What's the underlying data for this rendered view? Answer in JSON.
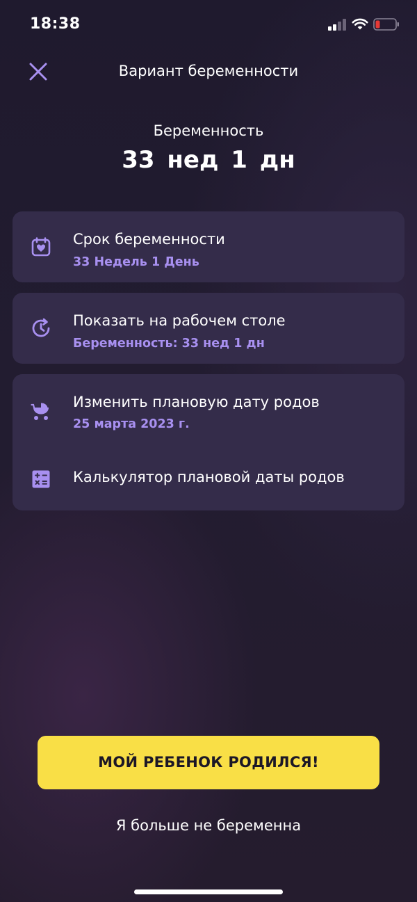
{
  "status_bar": {
    "time": "18:38",
    "icons": [
      "cellular-signal-icon",
      "wifi-icon",
      "battery-low-icon"
    ],
    "battery_color": "#e53935"
  },
  "header": {
    "title": "Вариант беременности",
    "close_icon": "close-icon"
  },
  "summary": {
    "label": "Беременность",
    "value": "33 нед 1 дн"
  },
  "card_term": {
    "icon": "calendar-heart-icon",
    "title": "Срок беременности",
    "subtitle": "33 Недель 1 День"
  },
  "card_widget": {
    "icon": "clock-refresh-icon",
    "title": "Показать на рабочем столе",
    "subtitle": "Беременность: 33 нед 1 дн"
  },
  "card_due": {
    "items": [
      {
        "icon": "stroller-icon",
        "title": "Изменить плановую дату родов",
        "subtitle": "25 марта 2023 г."
      },
      {
        "icon": "calculator-icon",
        "title": "Калькулятор плановой даты родов"
      }
    ]
  },
  "actions": {
    "born_button": "МОЙ РЕБЕНОК РОДИЛСЯ!",
    "not_pregnant_link": "Я больше не беременна"
  },
  "colors": {
    "accent": "#a890f0",
    "card": "#342c4a",
    "button": "#f9df46",
    "background": "#1f1a2e"
  }
}
